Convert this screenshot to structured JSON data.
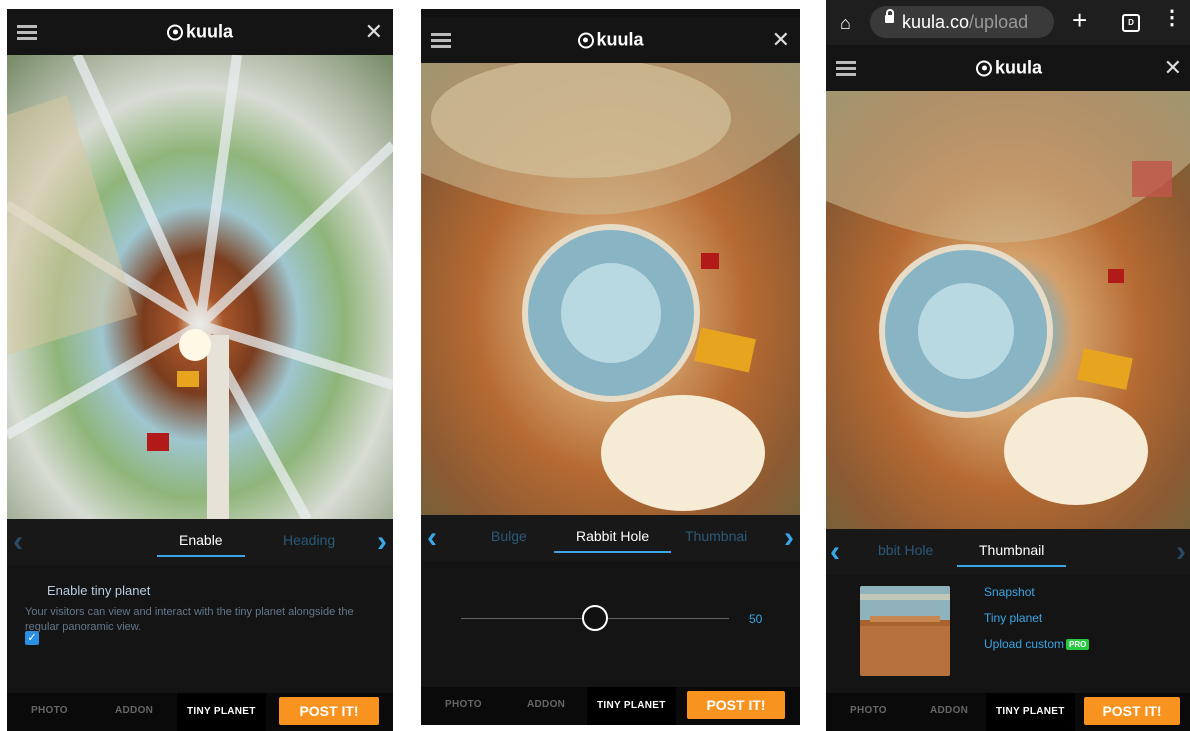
{
  "brand": "kuula",
  "colors": {
    "accent": "#3aa6e6",
    "post": "#f7931e",
    "pro": "#28c840"
  },
  "bottom_nav": {
    "photo": "PHOTO",
    "addon": "ADDON",
    "tiny_planet": "TINY PLANET",
    "post": "POST IT!"
  },
  "screens": [
    {
      "tabs": {
        "left": "",
        "active": "Enable",
        "right": "Heading"
      },
      "checkbox_label": "Enable tiny planet",
      "checkbox_checked": true,
      "description": "Your visitors can view and interact with the tiny planet alongside the regular panoramic view."
    },
    {
      "tabs": {
        "left": "Bulge",
        "active": "Rabbit Hole",
        "right": "Thumbnai"
      },
      "slider_value": "50"
    },
    {
      "browser": {
        "domain": "kuula.co",
        "path": "/upload",
        "tab_count": "D"
      },
      "tabs": {
        "left": "bbit Hole",
        "active": "Thumbnail",
        "right": ""
      },
      "thumbnail_options": [
        "Snapshot",
        "Tiny planet",
        "Upload custom"
      ],
      "pro_badge": "PRO"
    }
  ],
  "icons": {
    "menu": "hamburger-icon",
    "close": "close-icon",
    "prev": "chevron-left-icon",
    "next": "chevron-right-icon",
    "home": "home-icon",
    "lock": "lock-icon",
    "new_tab": "plus-icon",
    "tabs": "tab-switcher-icon",
    "more": "kebab-menu-icon"
  }
}
